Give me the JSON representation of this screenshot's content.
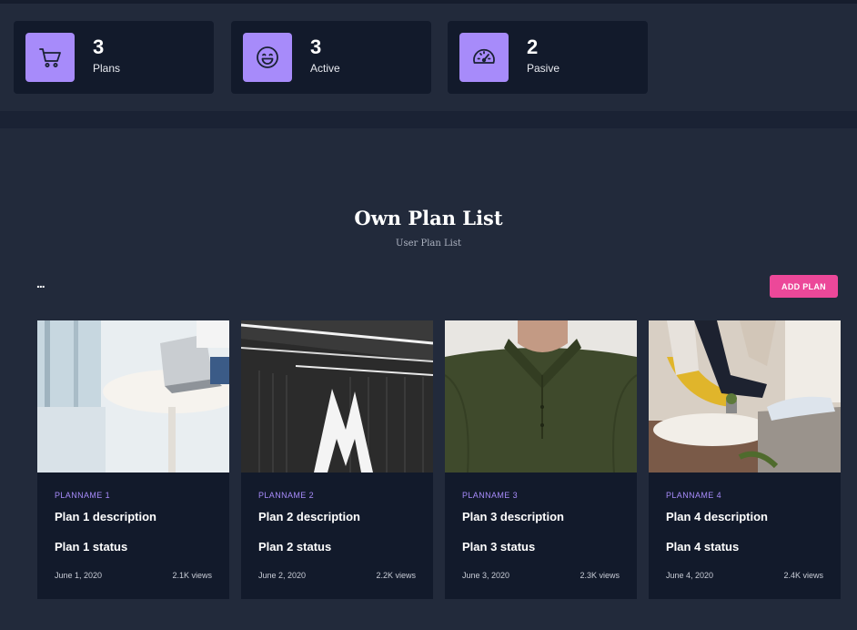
{
  "stats": [
    {
      "value": "3",
      "label": "Plans",
      "icon": "cart-icon"
    },
    {
      "value": "3",
      "label": "Active",
      "icon": "smiley-icon"
    },
    {
      "value": "2",
      "label": "Pasive",
      "icon": "gauge-icon"
    }
  ],
  "section": {
    "title": "Own Plan List",
    "subtitle": "User Plan List",
    "more_label": "...",
    "add_label": "ADD PLAN"
  },
  "cards": [
    {
      "name": "PLANNAME 1",
      "description": "Plan 1 description",
      "status": "Plan 1 status",
      "date": "June 1, 2020",
      "views": "2.1K views"
    },
    {
      "name": "PLANNAME 2",
      "description": "Plan 2 description",
      "status": "Plan 2 status",
      "date": "June 2, 2020",
      "views": "2.2K views"
    },
    {
      "name": "PLANNAME 3",
      "description": "Plan 3 description",
      "status": "Plan 3 status",
      "date": "June 3, 2020",
      "views": "2.3K views"
    },
    {
      "name": "PLANNAME 4",
      "description": "Plan 4 description",
      "status": "Plan 4 status",
      "date": "June 4, 2020",
      "views": "2.4K views"
    }
  ],
  "colors": {
    "accent": "#a78bfa",
    "button": "#ec4899",
    "card_bg": "#121a2b",
    "page_bg": "#222a3b"
  }
}
